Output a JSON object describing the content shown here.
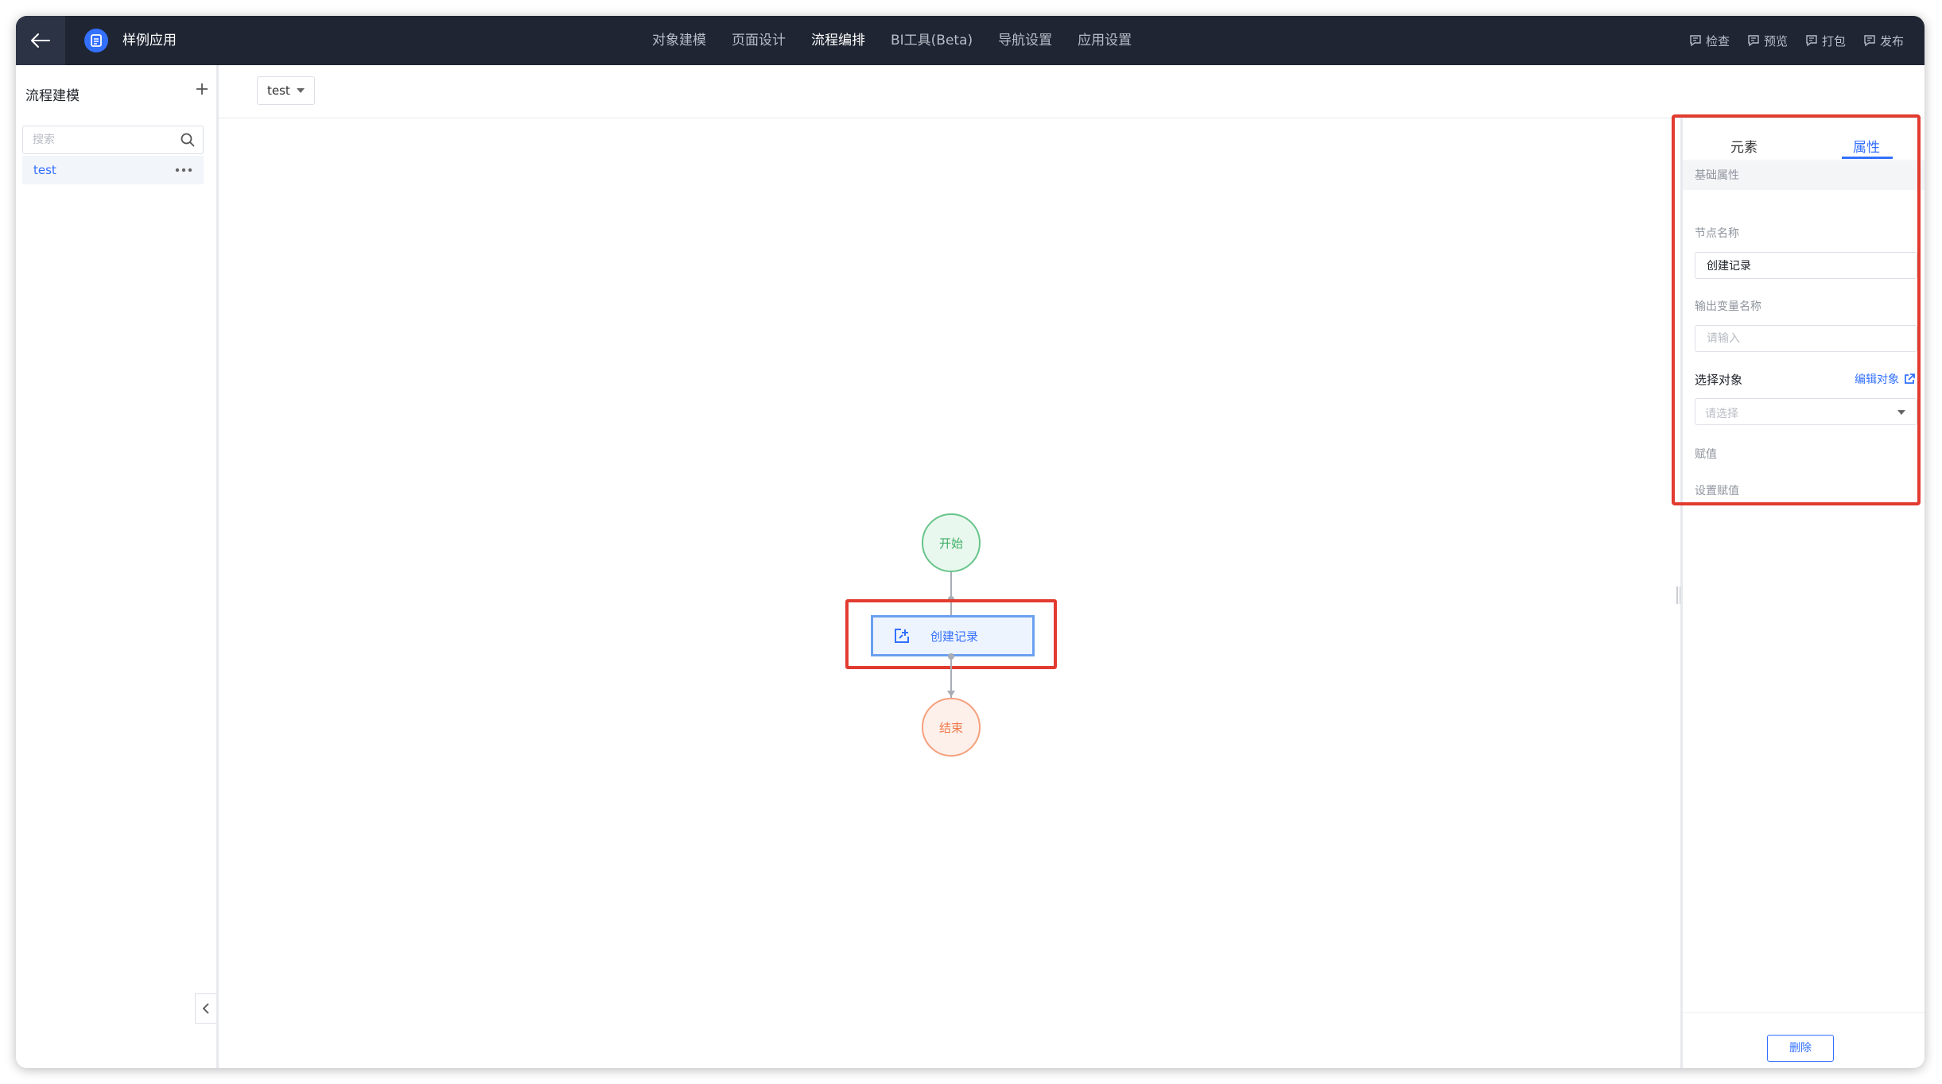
{
  "app": {
    "name": "样例应用"
  },
  "nav": {
    "items": [
      "对象建模",
      "页面设计",
      "流程编排",
      "BI工具(Beta)",
      "导航设置",
      "应用设置"
    ],
    "active": "流程编排"
  },
  "actions": {
    "check": "检查",
    "preview": "预览",
    "package": "打包",
    "publish": "发布"
  },
  "sidebar": {
    "title": "流程建模",
    "search_placeholder": "搜索",
    "items": [
      {
        "label": "test"
      }
    ]
  },
  "toolbar": {
    "selected_flow": "test"
  },
  "canvas": {
    "start_node": "开始",
    "task_node": "创建记录",
    "end_node": "结束"
  },
  "panel": {
    "tabs": [
      "元素",
      "属性"
    ],
    "active_tab": "属性",
    "section_title": "基础属性",
    "node_name_label": "节点名称",
    "node_name_value": "创建记录",
    "output_var_label": "输出变量名称",
    "output_var_placeholder": "请输入",
    "select_object_label": "选择对象",
    "edit_object_link": "编辑对象",
    "select_placeholder": "请选择",
    "assign_label": "赋值",
    "set_assign_label": "设置赋值",
    "delete_button": "删除"
  },
  "colors": {
    "accent": "#3370ff",
    "highlight": "#e23b2f",
    "topbar": "#1f2532"
  }
}
